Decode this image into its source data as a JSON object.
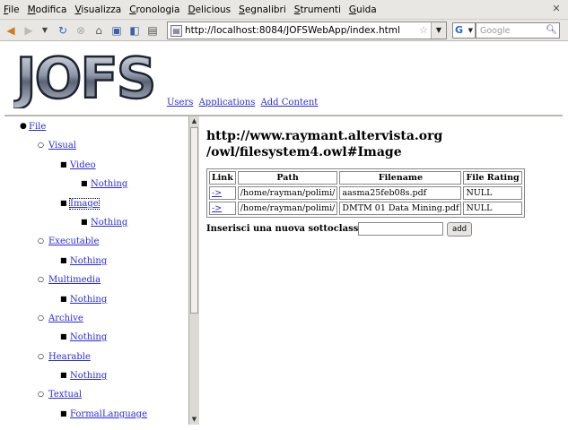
{
  "menubar": {
    "items": [
      "File",
      "Modifica",
      "Visualizza",
      "Cronologia",
      "Delicious",
      "Segnalibri",
      "Strumenti",
      "Guida"
    ]
  },
  "navbar": {
    "url": "http://localhost:8084/JOFSWebApp/index.html",
    "search_placeholder": "Google",
    "search_engine": "G"
  },
  "header": {
    "logo_text": "JOFS",
    "links": [
      "Users",
      "Applications",
      "Add Content"
    ]
  },
  "tree": {
    "root": "File",
    "categories": [
      {
        "label": "Visual"
      },
      {
        "label": "Video"
      },
      {
        "label": "Nothing"
      },
      {
        "label": "Image"
      },
      {
        "label": "Nothing"
      },
      {
        "label": "Executable"
      },
      {
        "label": "Nothing"
      },
      {
        "label": "Multimedia"
      },
      {
        "label": "Nothing"
      },
      {
        "label": "Archive"
      },
      {
        "label": "Nothing"
      },
      {
        "label": "Hearable"
      },
      {
        "label": "Nothing"
      },
      {
        "label": "Textual"
      },
      {
        "label": "FormalLanguage"
      }
    ]
  },
  "main": {
    "title_line1": "http://www.raymant.altervista.org",
    "title_line2": "/owl/filesystem4.owl#Image",
    "table": {
      "headers": [
        "Link",
        "Path",
        "Filename",
        "File Rating"
      ],
      "rows": [
        [
          "->",
          "/home/rayman/polimi/",
          "aasma25feb08s.pdf",
          "NULL"
        ],
        [
          "->",
          "/home/rayman/polimi/",
          "DMTM 01 Data Mining.pdf",
          "NULL"
        ]
      ]
    },
    "subclass_label": "Inserisci una nuova sottoclasse:",
    "add_button": "add"
  }
}
